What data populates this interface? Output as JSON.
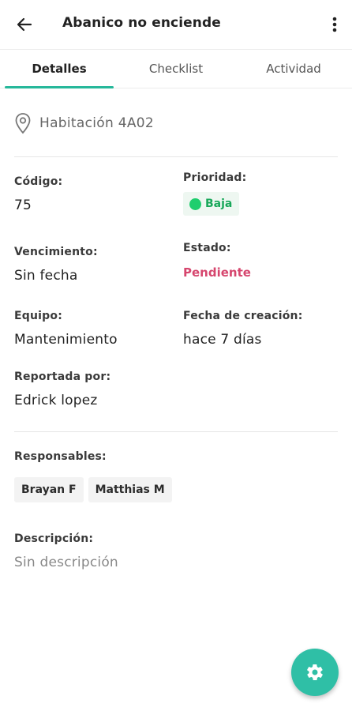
{
  "header": {
    "title": "Abanico no enciende",
    "back_icon": "arrow-left-icon",
    "more_icon": "more-vert-icon"
  },
  "tabs": [
    {
      "label": "Detalles",
      "active": true
    },
    {
      "label": "Checklist",
      "active": false
    },
    {
      "label": "Actividad",
      "active": false
    }
  ],
  "location": {
    "icon": "location-pin-icon",
    "text": "Habitación 4A02"
  },
  "details": {
    "code": {
      "label": "Código:",
      "value": "75"
    },
    "priority": {
      "label": "Prioridad:",
      "value": "Baja",
      "color": "#1fce6e"
    },
    "due": {
      "label": "Vencimiento:",
      "value": "Sin fecha"
    },
    "status": {
      "label": "Estado:",
      "value": "Pendiente",
      "color": "#d6466e"
    },
    "team": {
      "label": "Equipo:",
      "value": "Mantenimiento"
    },
    "created": {
      "label": "Fecha de creación:",
      "value": "hace 7 días"
    },
    "reported_by": {
      "label": "Reportada por:",
      "value": "Edrick lopez"
    }
  },
  "responsables": {
    "label": "Responsables:",
    "people": [
      "Brayan F",
      "Matthias M"
    ]
  },
  "description": {
    "label": "Descripción:",
    "value": "Sin descripción"
  },
  "fab": {
    "icon": "gear-icon",
    "color": "#2fbfa6"
  },
  "colors": {
    "accent": "#26b89a"
  }
}
